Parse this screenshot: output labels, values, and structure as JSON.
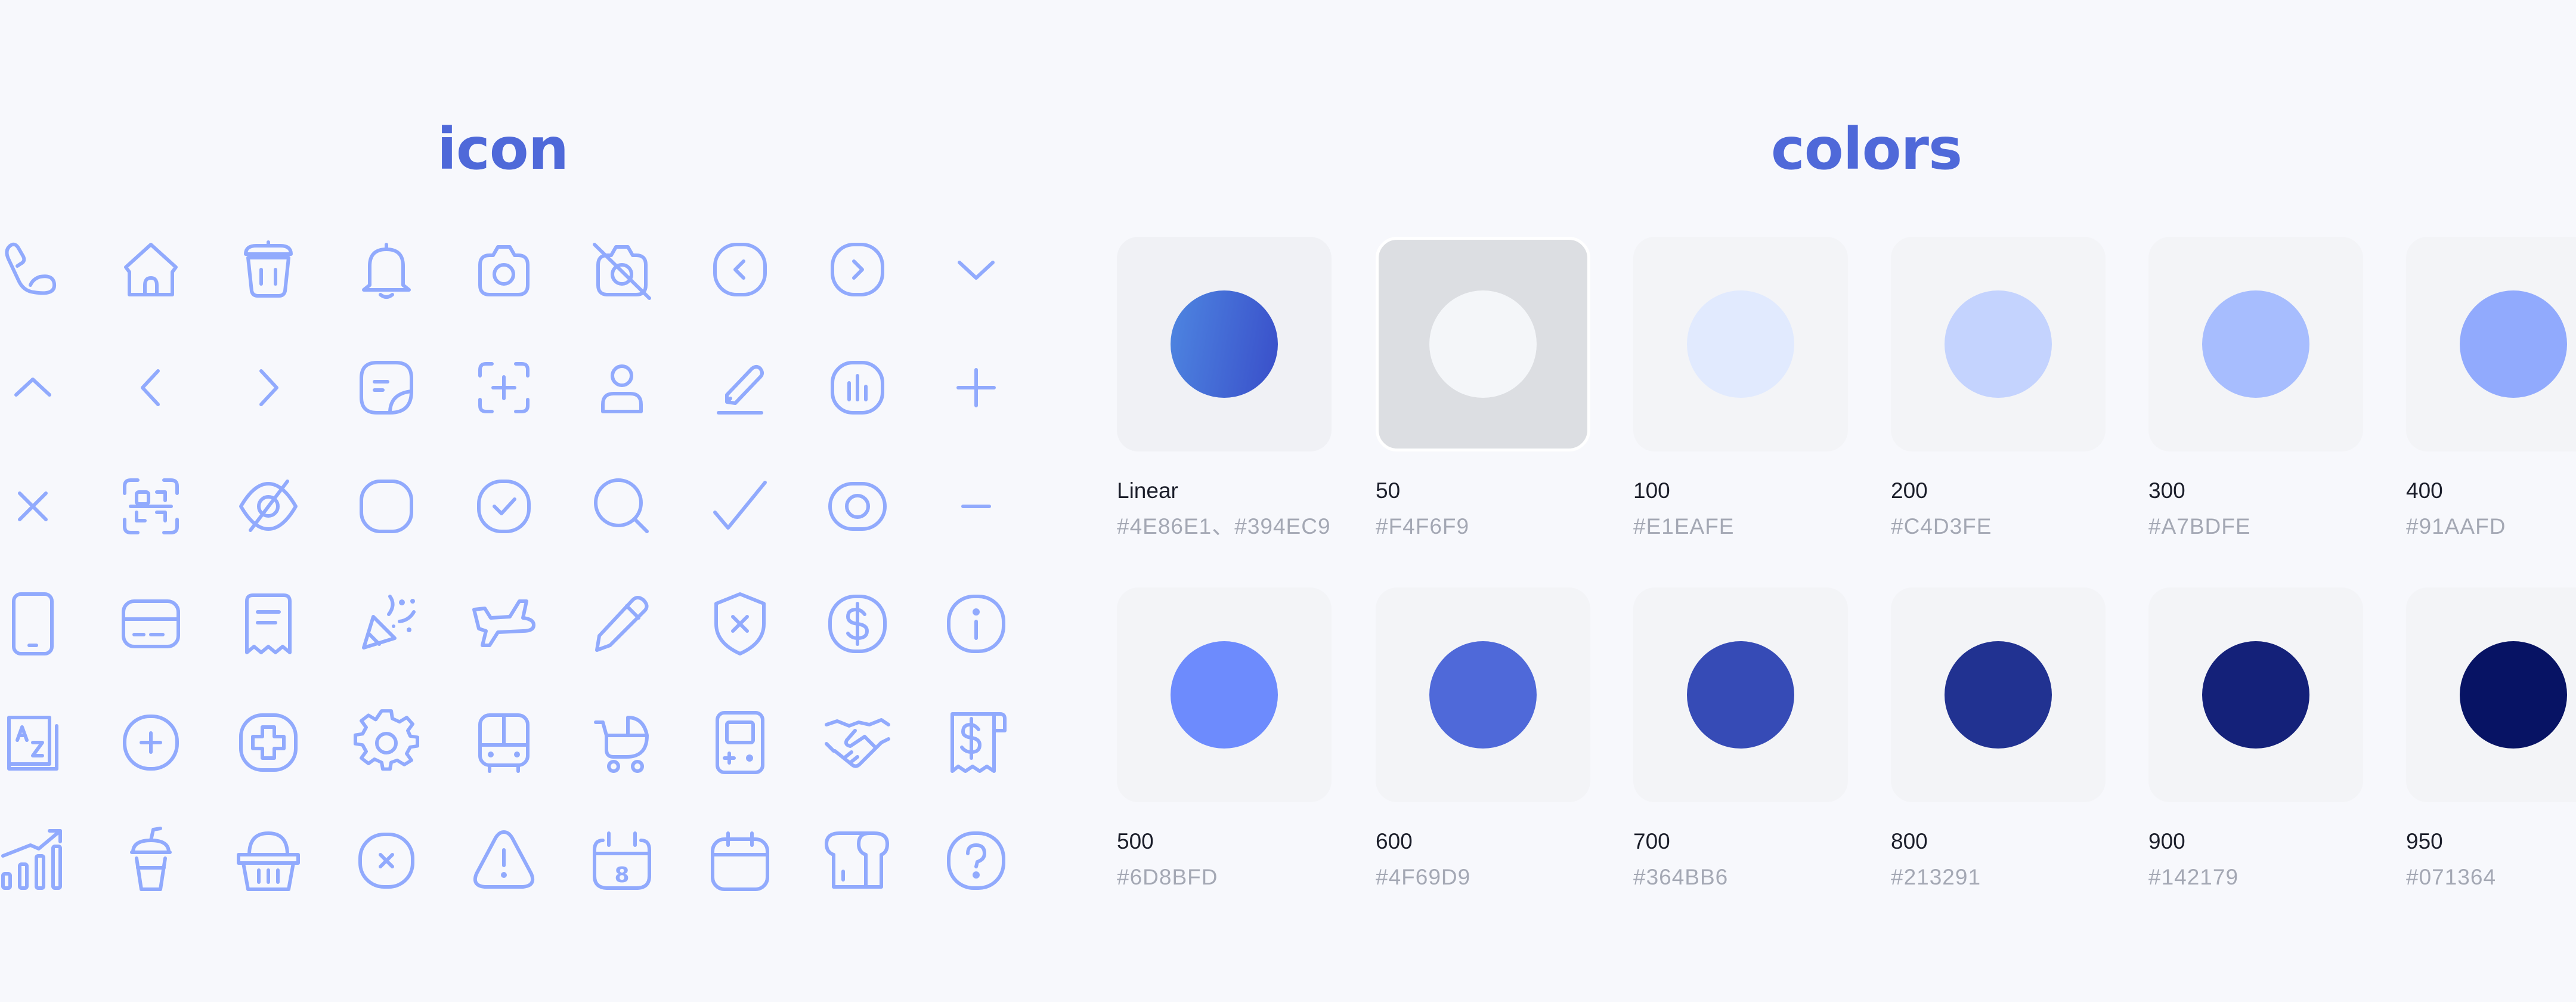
{
  "titles": {
    "icon": "icon",
    "colors": "colors"
  },
  "icons": [
    [
      "phone-icon",
      "home-icon",
      "trash-icon",
      "bell-icon",
      "camera-icon",
      "camera-off-icon",
      "chevron-left-circle-icon",
      "chevron-right-circle-icon",
      "chevron-down-icon"
    ],
    [
      "chevron-up-icon",
      "chevron-left-icon",
      "chevron-right-icon",
      "sticker-icon",
      "scan-add-icon",
      "user-icon",
      "edit-line-icon",
      "chart-square-icon",
      "plus-icon"
    ],
    [
      "close-icon",
      "scan-face-icon",
      "eye-off-icon",
      "square-rounded-icon",
      "check-circle-icon",
      "search-icon",
      "checkmark-icon",
      "eye-icon",
      "minus-icon"
    ],
    [
      "mobile-icon",
      "credit-card-icon",
      "receipt-icon",
      "party-icon",
      "plane-icon",
      "pen-icon",
      "shield-x-icon",
      "dollar-circle-icon",
      "info-circle-icon"
    ],
    [
      "dictionary-icon",
      "plus-circle-icon",
      "medical-cross-icon",
      "settings-gear-icon",
      "bus-icon",
      "stroller-icon",
      "game-console-icon",
      "handshake-icon",
      "invoice-dollar-icon"
    ],
    [
      "growth-chart-icon",
      "drink-cup-icon",
      "shopping-basket-icon",
      "close-circle-icon",
      "warning-icon",
      "calendar-8-icon",
      "calendar-icon",
      "bread-icon",
      "help-circle-icon"
    ]
  ],
  "calendar_day": "8",
  "dollar_sign": "$",
  "swatches": [
    {
      "name": "Linear",
      "hex": "#4E86E1、#394EC9",
      "gradient": [
        "#4E86E1",
        "#394EC9"
      ]
    },
    {
      "name": "50",
      "hex": "#F4F6F9",
      "color": "#F4F6F9"
    },
    {
      "name": "100",
      "hex": "#E1EAFE",
      "color": "#E1EAFE"
    },
    {
      "name": "200",
      "hex": "#C4D3FE",
      "color": "#C4D3FE"
    },
    {
      "name": "300",
      "hex": "#A7BDFE",
      "color": "#A7BDFE"
    },
    {
      "name": "400",
      "hex": "#91AAFD",
      "color": "#91AAFD"
    },
    {
      "name": "500",
      "hex": "#6D8BFD",
      "color": "#6D8BFD"
    },
    {
      "name": "600",
      "hex": "#4F69D9",
      "color": "#4F69D9"
    },
    {
      "name": "700",
      "hex": "#364BB6",
      "color": "#364BB6"
    },
    {
      "name": "800",
      "hex": "#213291",
      "color": "#213291"
    },
    {
      "name": "900",
      "hex": "#142179",
      "color": "#142179"
    },
    {
      "name": "950",
      "hex": "#071364",
      "color": "#071364"
    }
  ],
  "colors": {
    "accent": "#4F69D9",
    "icon_stroke": "#91AAFD",
    "background": "#F7F8FC"
  }
}
